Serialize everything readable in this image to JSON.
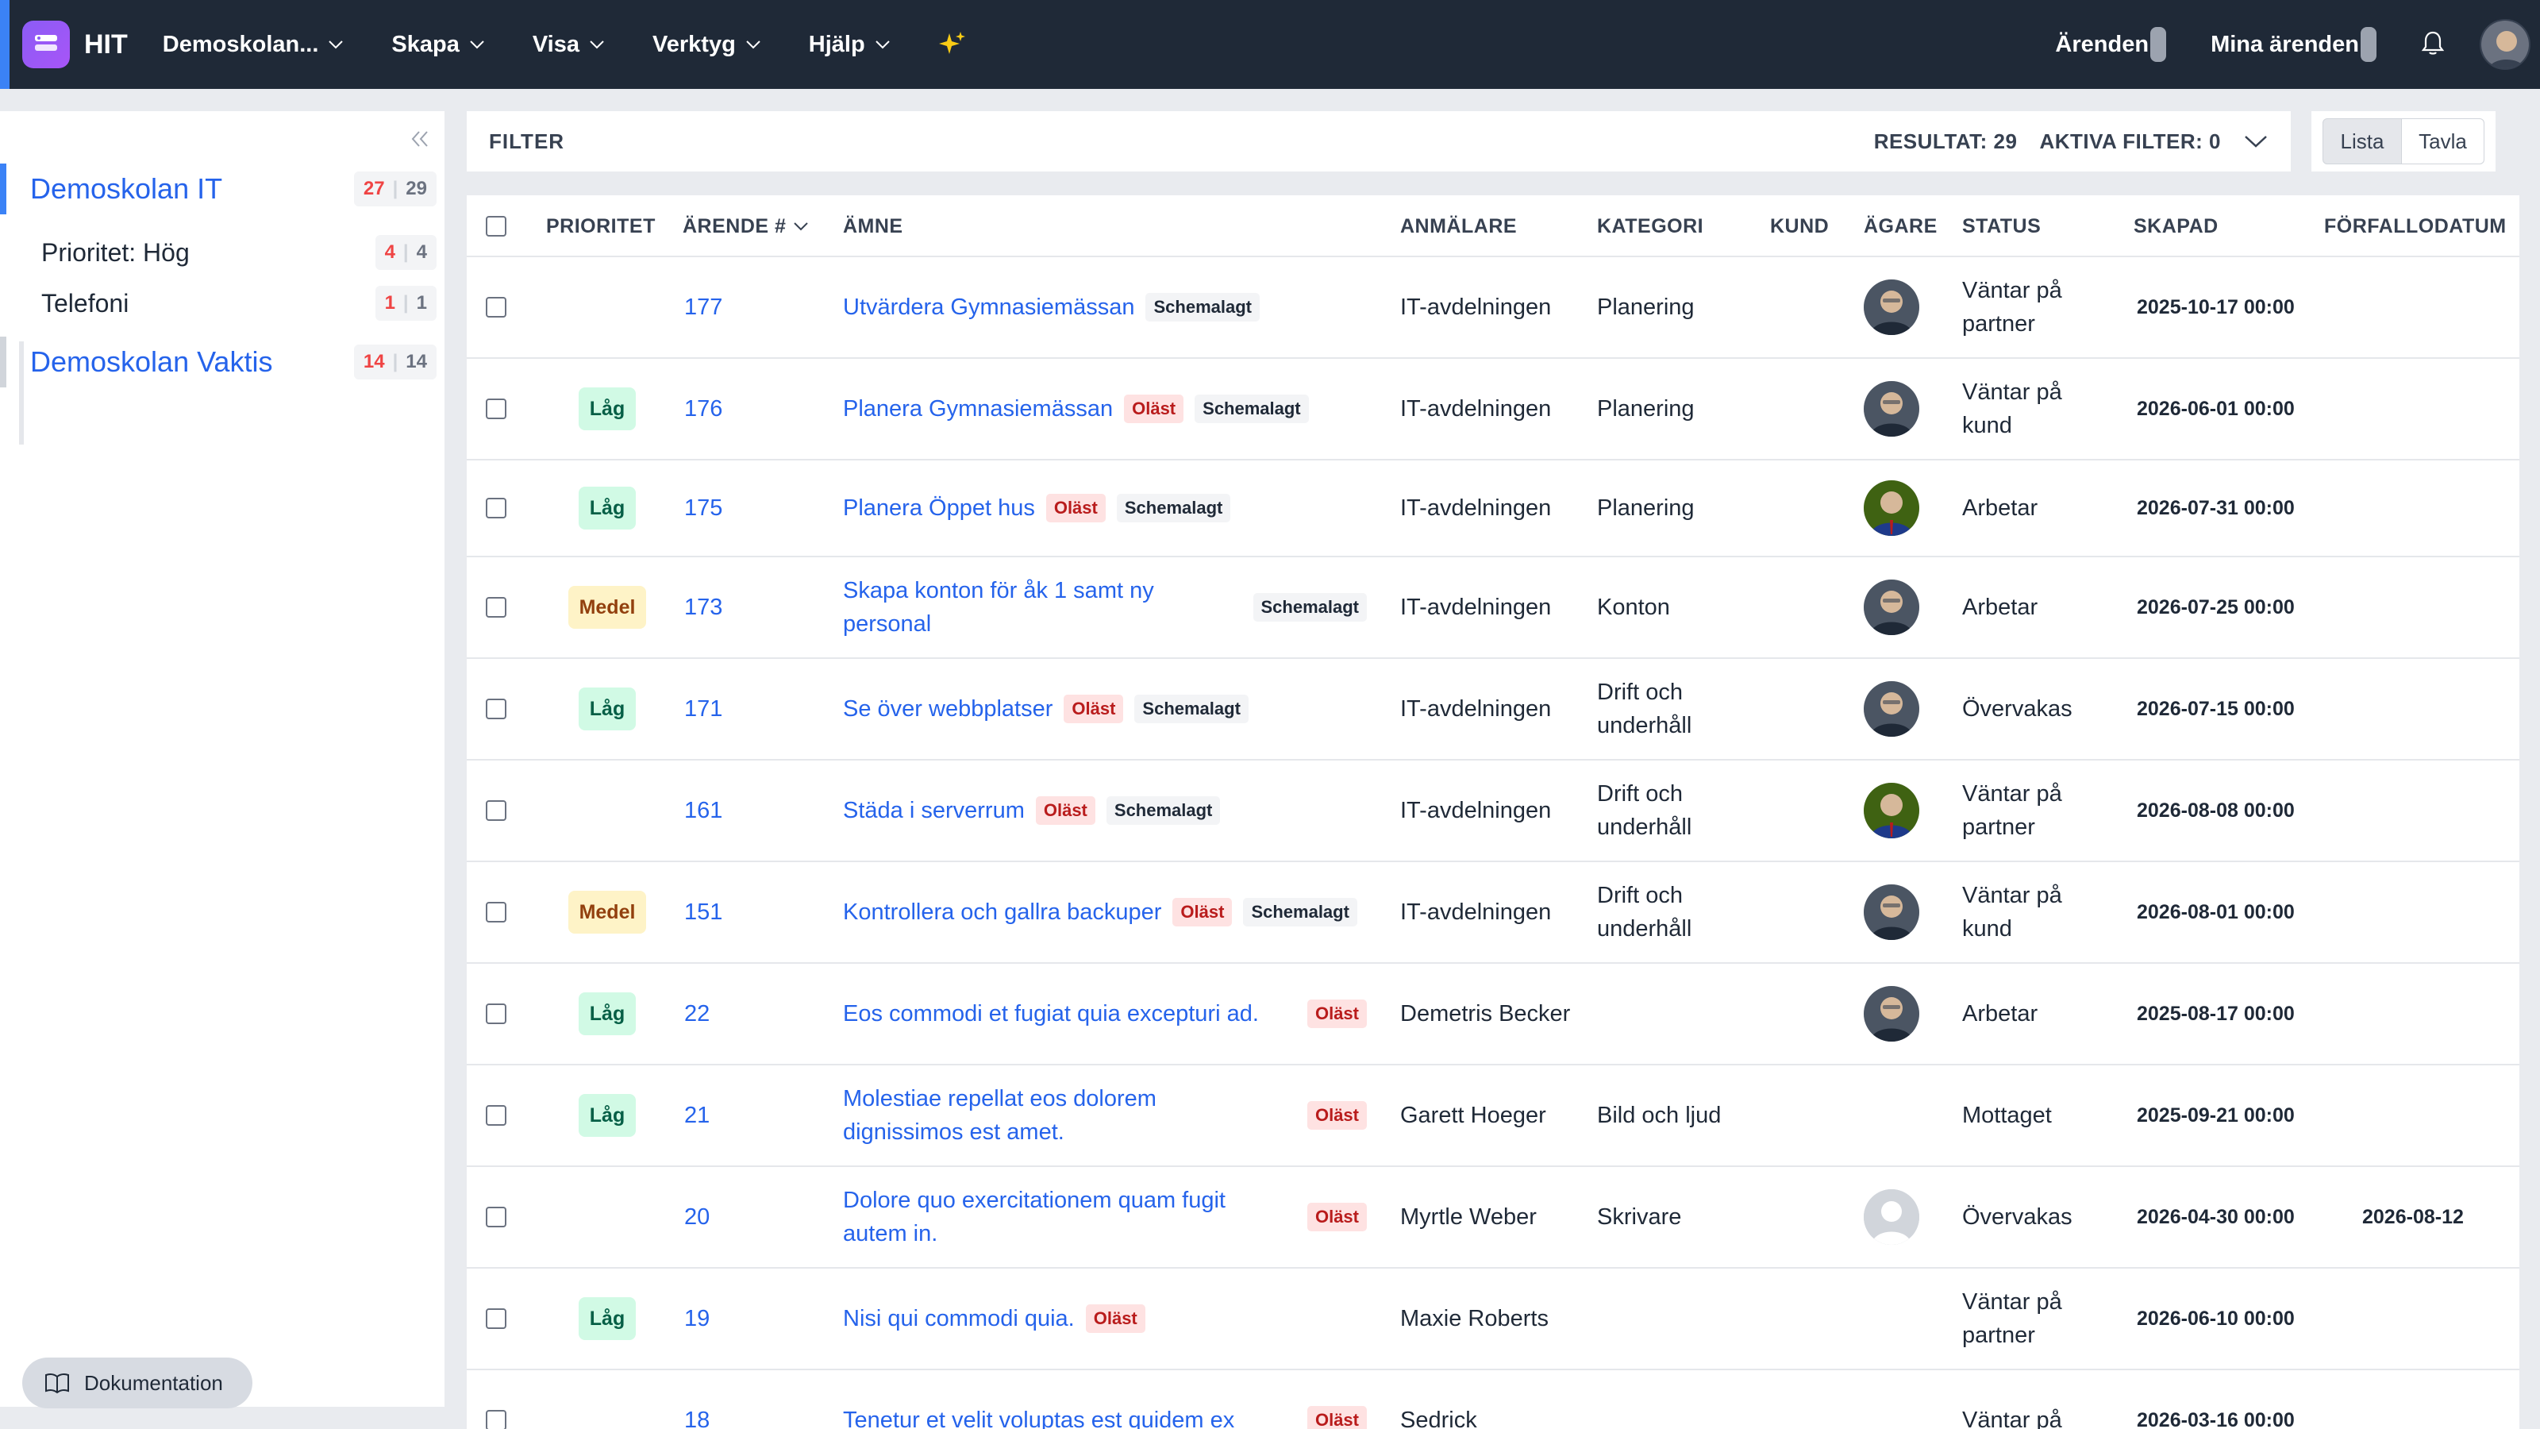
{
  "topbar": {
    "brand": "HIT",
    "menu": [
      {
        "label": "Demoskolan..."
      },
      {
        "label": "Skapa"
      },
      {
        "label": "Visa"
      },
      {
        "label": "Verktyg"
      },
      {
        "label": "Hjälp"
      }
    ],
    "right": {
      "cases": "Ärenden",
      "my_cases": "Mina ärenden"
    }
  },
  "sidebar": {
    "groups": [
      {
        "label": "Demoskolan IT",
        "unread": "27",
        "total": "29"
      },
      {
        "label": "Demoskolan Vaktis",
        "unread": "14",
        "total": "14"
      }
    ],
    "subitems": [
      {
        "label": "Prioritet: Hög",
        "unread": "4",
        "total": "4"
      },
      {
        "label": "Telefoni",
        "unread": "1",
        "total": "1"
      }
    ],
    "doc_button": "Dokumentation"
  },
  "filter": {
    "title": "FILTER",
    "results": "RESULTAT: 29",
    "active": "AKTIVA FILTER: 0"
  },
  "view": {
    "list": "Lista",
    "board": "Tavla"
  },
  "table": {
    "headers": {
      "priority": "PRIORITET",
      "case": "ÄRENDE #",
      "subject": "ÄMNE",
      "reporter": "ANMÄLARE",
      "category": "KATEGORI",
      "customer": "KUND",
      "owner": "ÄGARE",
      "status": "STATUS",
      "created": "SKAPAD",
      "due": "FÖRFALLODATUM"
    },
    "badges": {
      "unread": "Oläst",
      "scheduled": "Schemalagt"
    },
    "rows": [
      {
        "priority": "",
        "prio_type": "",
        "id": "177",
        "subject": "Utvärdera Gymnasiemässan",
        "unread": false,
        "scheduled": true,
        "reporter": "IT-avdelningen",
        "category": "Planering",
        "owner": "a",
        "status": "Väntar på partner",
        "created": "2025-10-17 00:00",
        "due": ""
      },
      {
        "priority": "Låg",
        "prio_type": "low",
        "id": "176",
        "subject": "Planera Gymnasiemässan",
        "unread": true,
        "scheduled": true,
        "reporter": "IT-avdelningen",
        "category": "Planering",
        "owner": "a",
        "status": "Väntar på kund",
        "created": "2026-06-01 00:00",
        "due": ""
      },
      {
        "priority": "Låg",
        "prio_type": "low",
        "id": "175",
        "subject": "Planera Öppet hus",
        "unread": true,
        "scheduled": true,
        "reporter": "IT-avdelningen",
        "category": "Planering",
        "owner": "b",
        "status": "Arbetar",
        "created": "2026-07-31 00:00",
        "due": ""
      },
      {
        "priority": "Medel",
        "prio_type": "med",
        "id": "173",
        "subject": "Skapa konton för åk 1 samt ny personal",
        "unread": false,
        "scheduled": true,
        "reporter": "IT-avdelningen",
        "category": "Konton",
        "owner": "a",
        "status": "Arbetar",
        "created": "2026-07-25 00:00",
        "due": ""
      },
      {
        "priority": "Låg",
        "prio_type": "low",
        "id": "171",
        "subject": "Se över webbplatser",
        "unread": true,
        "scheduled": true,
        "reporter": "IT-avdelningen",
        "category": "Drift och underhåll",
        "owner": "a",
        "status": "Övervakas",
        "created": "2026-07-15 00:00",
        "due": ""
      },
      {
        "priority": "",
        "prio_type": "",
        "id": "161",
        "subject": "Städa i serverrum",
        "unread": true,
        "scheduled": true,
        "reporter": "IT-avdelningen",
        "category": "Drift och underhåll",
        "owner": "b",
        "status": "Väntar på partner",
        "created": "2026-08-08 00:00",
        "due": ""
      },
      {
        "priority": "Medel",
        "prio_type": "med",
        "id": "151",
        "subject": "Kontrollera och gallra backuper",
        "unread": true,
        "scheduled": true,
        "reporter": "IT-avdelningen",
        "category": "Drift och underhåll",
        "owner": "a",
        "status": "Väntar på kund",
        "created": "2026-08-01 00:00",
        "due": ""
      },
      {
        "priority": "Låg",
        "prio_type": "low",
        "id": "22",
        "subject": "Eos commodi et fugiat quia excepturi ad.",
        "unread": true,
        "scheduled": false,
        "reporter": "Demetris Becker",
        "category": "",
        "owner": "a",
        "status": "Arbetar",
        "created": "2025-08-17 00:00",
        "due": ""
      },
      {
        "priority": "Låg",
        "prio_type": "low",
        "id": "21",
        "subject": "Molestiae repellat eos dolorem dignissimos est amet.",
        "unread": true,
        "scheduled": false,
        "reporter": "Garett Hoeger",
        "category": "Bild och ljud",
        "owner": "",
        "status": "Mottaget",
        "created": "2025-09-21 00:00",
        "due": ""
      },
      {
        "priority": "",
        "prio_type": "",
        "id": "20",
        "subject": "Dolore quo exercitationem quam fugit autem in.",
        "unread": true,
        "scheduled": false,
        "reporter": "Myrtle Weber",
        "category": "Skrivare",
        "owner": "blank",
        "status": "Övervakas",
        "created": "2026-04-30 00:00",
        "due": "2026-08-12"
      },
      {
        "priority": "Låg",
        "prio_type": "low",
        "id": "19",
        "subject": "Nisi qui commodi quia.",
        "unread": true,
        "scheduled": false,
        "reporter": "Maxie Roberts",
        "category": "",
        "owner": "",
        "status": "Väntar på partner",
        "created": "2026-06-10 00:00",
        "due": ""
      },
      {
        "priority": "",
        "prio_type": "",
        "id": "18",
        "subject": "Tenetur et velit voluptas est quidem ex",
        "unread": true,
        "scheduled": false,
        "reporter": "Sedrick",
        "category": "",
        "owner": "",
        "status": "Väntar på",
        "created": "2026-03-16 00:00",
        "due": ""
      }
    ]
  }
}
